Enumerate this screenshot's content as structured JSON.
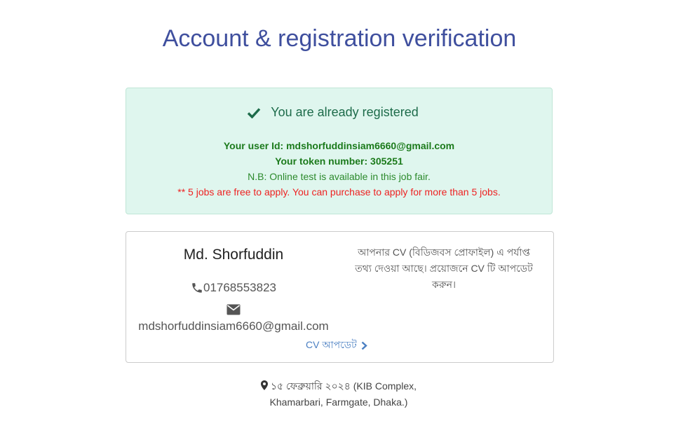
{
  "page": {
    "title": "Account & registration verification"
  },
  "alert": {
    "heading": "You are already registered",
    "user_id": "Your user Id: mdshorfuddinsiam6660@gmail.com",
    "token": "Your token number: 305251",
    "note": "N.B: Online test is available in this job fair.",
    "warning": "** 5 jobs are free to apply. You can purchase to apply for more than 5 jobs.",
    "colors": {
      "background": "#dff6ee",
      "text": "#1d6b4a",
      "warning": "#ee2222"
    }
  },
  "profile": {
    "name": "Md. Shorfuddin",
    "phone": "01768553823",
    "email": "mdshorfuddinsiam6660@gmail.com",
    "cv_link": "CV আপডেট",
    "cv_note": "আপনার CV (বিডিজবস প্রোফাইল) এ পর্যাপ্ত তথ্য দেওয়া আছে। প্রয়োজনে CV টি আপডেট করুন।"
  },
  "venue": {
    "line1": "১৫ ফেব্রুয়ারি ২০২৪ (KIB Complex,",
    "line2": "Khamarbari, Farmgate, Dhaka.)"
  }
}
